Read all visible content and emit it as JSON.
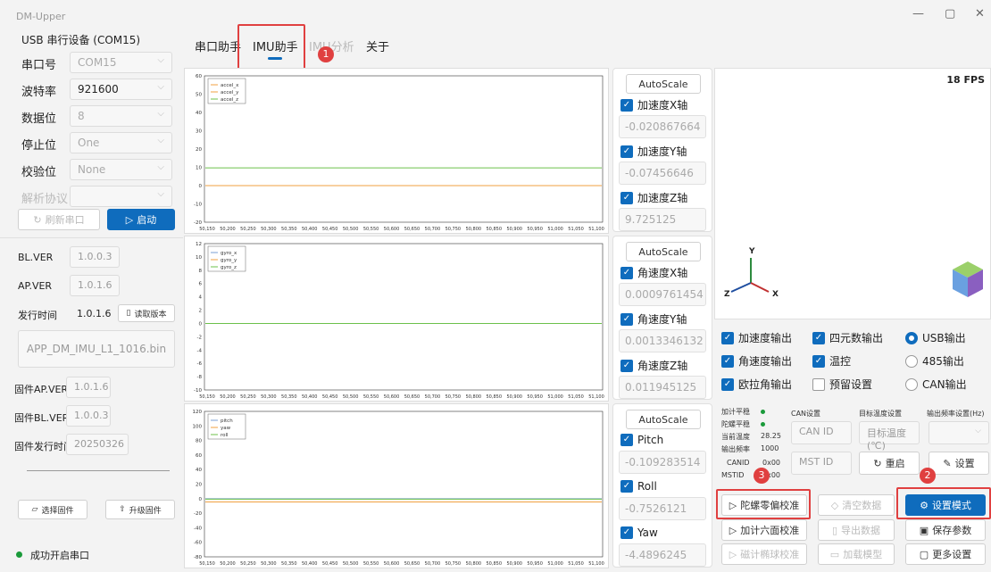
{
  "window": {
    "title": "DM-Upper",
    "min_icon": "minimize-icon",
    "max_icon": "maximize-icon",
    "close_icon": "close-icon"
  },
  "left": {
    "device": "USB 串行设备 (COM15)",
    "fields": [
      {
        "label": "串口号",
        "value": "COM15"
      },
      {
        "label": "波特率",
        "value": "921600"
      },
      {
        "label": "数据位",
        "value": "8"
      },
      {
        "label": "停止位",
        "value": "One"
      },
      {
        "label": "校验位",
        "value": "None"
      },
      {
        "label": "解析协议",
        "value": ""
      }
    ],
    "refresh_label": "刷新串口",
    "start_label": "启动",
    "bl_ver_label": "BL.VER",
    "bl_ver": "1.0.0.3",
    "ap_ver_label": "AP.VER",
    "ap_ver": "1.0.1.6",
    "release_label": "发行时间",
    "release": "1.0.1.6",
    "read_version_label": "读取版本",
    "firmware_file": "APP_DM_IMU_L1_1016.bin",
    "fw_ap_label": "固件AP.VER",
    "fw_ap": "1.0.1.6",
    "fw_bl_label": "固件BL.VER",
    "fw_bl": "1.0.0.3",
    "fw_date_label": "固件发行时间",
    "fw_date": "20250326",
    "select_fw_label": "选择固件",
    "upgrade_fw_label": "升级固件",
    "status_text": "成功开启串口",
    "status_color": "#1a9a3a"
  },
  "tabs": [
    {
      "label": "串口助手",
      "active": false
    },
    {
      "label": "IMU助手",
      "active": true
    },
    {
      "label": "IMU分析",
      "active": false
    },
    {
      "label": "关于",
      "active": false
    }
  ],
  "annotations": [
    "1",
    "2",
    "3"
  ],
  "chart_data": [
    {
      "type": "line",
      "series": [
        {
          "name": "accel_x",
          "values": [
            0.0,
            0.0
          ],
          "color": "#f0a040"
        },
        {
          "name": "accel_y",
          "values": [
            0.0,
            0.0
          ],
          "color": "#f0a040"
        },
        {
          "name": "accel_z",
          "values": [
            9.7,
            9.7
          ],
          "color": "#6cc04a"
        }
      ],
      "x": [
        50150,
        51100
      ],
      "xticks": [
        "50,150",
        "50,200",
        "50,250",
        "50,300",
        "50,350",
        "50,400",
        "50,450",
        "50,500",
        "50,550",
        "50,600",
        "50,650",
        "50,700",
        "50,750",
        "50,800",
        "50,850",
        "50,900",
        "50,950",
        "51,000",
        "51,050",
        "51,100"
      ],
      "yticks": [
        "60",
        "50",
        "40",
        "30",
        "20",
        "10",
        "0",
        "-10",
        "-20"
      ],
      "ylim": [
        -20,
        60
      ]
    },
    {
      "type": "line",
      "series": [
        {
          "name": "gyro_x",
          "values": [
            0.0,
            0.0
          ],
          "color": "#7a9fd4"
        },
        {
          "name": "gyro_y",
          "values": [
            0.0,
            0.0
          ],
          "color": "#f0a040"
        },
        {
          "name": "gyro_z",
          "values": [
            0.0,
            0.0
          ],
          "color": "#6cc04a"
        }
      ],
      "x": [
        50150,
        51100
      ],
      "xticks": [
        "50,150",
        "50,200",
        "50,250",
        "50,300",
        "50,350",
        "50,400",
        "50,450",
        "50,500",
        "50,550",
        "50,600",
        "50,650",
        "50,700",
        "50,750",
        "50,800",
        "50,850",
        "50,900",
        "50,950",
        "51,000",
        "51,050",
        "51,100"
      ],
      "yticks": [
        "12",
        "10",
        "8",
        "6",
        "4",
        "2",
        "0",
        "-2",
        "-4",
        "-6",
        "-8",
        "-10"
      ],
      "ylim": [
        -10,
        12
      ]
    },
    {
      "type": "line",
      "series": [
        {
          "name": "pitch",
          "values": [
            -0.1,
            -0.1
          ],
          "color": "#7a9fd4"
        },
        {
          "name": "yaw",
          "values": [
            -4.5,
            -4.5
          ],
          "color": "#f0a040"
        },
        {
          "name": "roll",
          "values": [
            -0.75,
            -0.75
          ],
          "color": "#6cc04a"
        }
      ],
      "x": [
        50150,
        51100
      ],
      "xticks": [
        "50,150",
        "50,200",
        "50,250",
        "50,300",
        "50,350",
        "50,400",
        "50,450",
        "50,500",
        "50,550",
        "50,600",
        "50,650",
        "50,700",
        "50,750",
        "50,800",
        "50,850",
        "50,900",
        "50,950",
        "51,000",
        "51,050",
        "51,100"
      ],
      "yticks": [
        "120",
        "100",
        "80",
        "60",
        "40",
        "20",
        "0",
        "-20",
        "-40",
        "-60",
        "-80"
      ],
      "ylim": [
        -80,
        120
      ]
    }
  ],
  "channels": [
    {
      "autoscale": "AutoScale",
      "items": [
        {
          "label": "加速度X轴",
          "value": "-0.020867664"
        },
        {
          "label": "加速度Y轴",
          "value": "-0.07456646"
        },
        {
          "label": "加速度Z轴",
          "value": "9.725125"
        }
      ]
    },
    {
      "autoscale": "AutoScale",
      "items": [
        {
          "label": "角速度X轴",
          "value": "0.0009761454"
        },
        {
          "label": "角速度Y轴",
          "value": "0.0013346132"
        },
        {
          "label": "角速度Z轴",
          "value": "0.011945125"
        }
      ]
    },
    {
      "autoscale": "AutoScale",
      "items": [
        {
          "label": "Pitch",
          "value": "-0.109283514"
        },
        {
          "label": "Roll",
          "value": "-0.7526121"
        },
        {
          "label": "Yaw",
          "value": "-4.4896245"
        }
      ]
    }
  ],
  "viewer": {
    "fps": "18 FPS",
    "axis_y": "Y",
    "axis_z": "Z",
    "axis_x": "X"
  },
  "outputs": {
    "col1": [
      {
        "label": "加速度输出",
        "checked": true
      },
      {
        "label": "角速度输出",
        "checked": true
      },
      {
        "label": "欧拉角输出",
        "checked": true
      }
    ],
    "col2": [
      {
        "label": "四元数输出",
        "checked": true
      },
      {
        "label": "温控",
        "checked": true
      },
      {
        "label": "预留设置",
        "checked": false
      }
    ],
    "col3": [
      {
        "label": "USB输出",
        "checked": true
      },
      {
        "label": "485输出",
        "checked": false
      },
      {
        "label": "CAN输出",
        "checked": false
      }
    ]
  },
  "status": {
    "accel_flat": "加计平稳",
    "gyro_flat": "陀螺平稳",
    "temp_label": "当前温度",
    "temp": "28.25",
    "freq_label": "输出频率",
    "freq": "1000",
    "canid_label": "CANID",
    "canid": "0x00",
    "mstid_label": "MSTID",
    "mstid": "0x00",
    "can_settings": "CAN设置",
    "target_temp_settings": "目标温度设置",
    "freq_settings": "输出频率设置(Hz)",
    "can_id_ph": "CAN ID",
    "target_temp_ph": "目标温度(℃)",
    "mst_id_ph": "MST ID",
    "restart_label": "重启",
    "set_label": "设置"
  },
  "actions": {
    "gyro_calib": "陀螺零偏校准",
    "clear_data": "清空数据",
    "set_mode": "设置模式",
    "accel_calib": "加计六面校准",
    "export_data": "导出数据",
    "save_params": "保存参数",
    "mag_calib": "磁计椭球校准",
    "load_model": "加载模型",
    "more_settings": "更多设置"
  }
}
